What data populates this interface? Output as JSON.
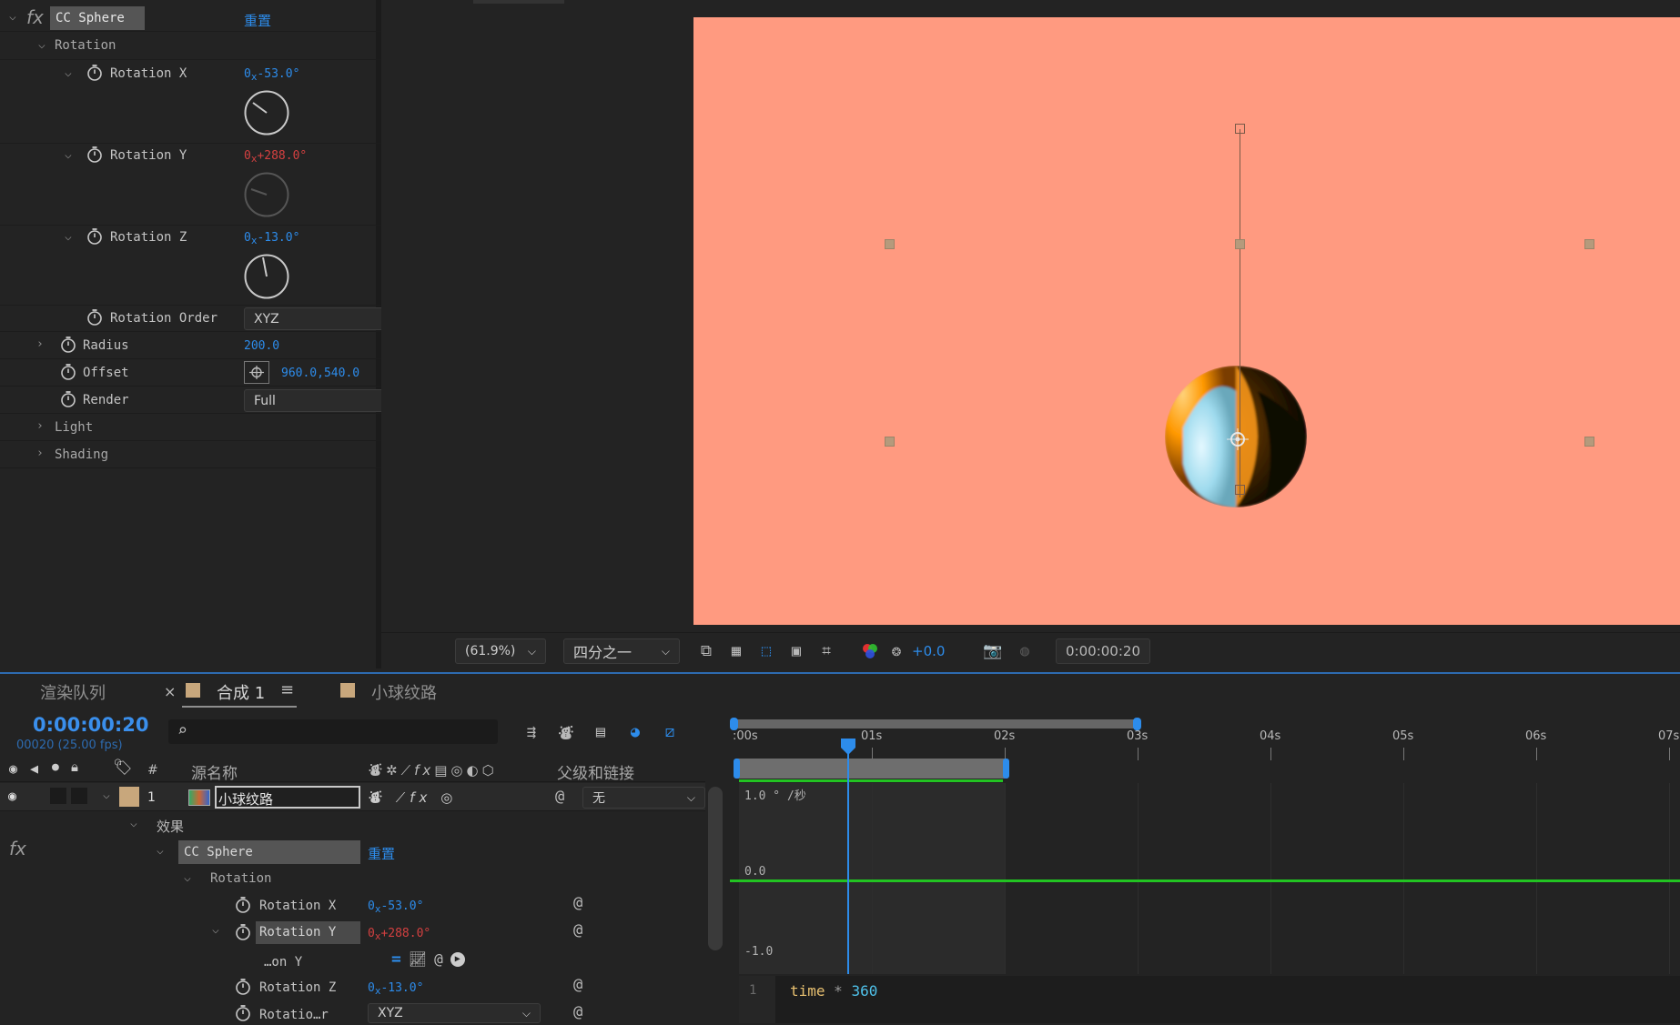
{
  "effect_controls": {
    "fx_label": "fx",
    "effect_name": "CC Sphere",
    "reset_label": "重置",
    "group_rotation": "Rotation",
    "rotation_x": {
      "label": "Rotation X",
      "revolutions": "0",
      "x": "x",
      "degrees": "-53.0",
      "unit": "°"
    },
    "rotation_y": {
      "label": "Rotation Y",
      "revolutions": "0",
      "x": "x",
      "degrees": "+288.0",
      "unit": "°"
    },
    "rotation_z": {
      "label": "Rotation Z",
      "revolutions": "0",
      "x": "x",
      "degrees": "-13.0",
      "unit": "°"
    },
    "rotation_order": {
      "label": "Rotation Order",
      "value": "XYZ"
    },
    "radius": {
      "label": "Radius",
      "value": "200.0"
    },
    "offset": {
      "label": "Offset",
      "value": "960.0,540.0"
    },
    "render": {
      "label": "Render",
      "value": "Full"
    },
    "light": "Light",
    "shading": "Shading"
  },
  "viewer": {
    "background_color": "#ff9a80",
    "zoom": "(61.9%)",
    "resolution": "四分之一",
    "exposure": "+0.0",
    "timecode": "0:00:00:20"
  },
  "tabs": {
    "render_queue": "渲染队列",
    "comp": "合成 1",
    "footage": "小球纹路"
  },
  "timeline": {
    "current_time": "0:00:00:20",
    "frame_info": "00020 (25.00 fps)",
    "search_placeholder": "",
    "col_hash": "#",
    "col_source_name": "源名称",
    "col_parent": "父级和链接",
    "layer": {
      "index": "1",
      "name": "小球纹路",
      "parent": "无",
      "label_color": "#c8a77c"
    },
    "effects_group": "效果",
    "fx_label": "fx",
    "effect_name": "CC Sphere",
    "reset_label": "重置",
    "rotation_group": "Rotation",
    "rot_x": {
      "label": "Rotation X",
      "revolutions": "0",
      "x": "x",
      "degrees": "-53.0",
      "unit": "°"
    },
    "rot_y": {
      "label": "Rotation Y",
      "revolutions": "0",
      "x": "x",
      "degrees": "+288.0",
      "unit": "°"
    },
    "expr_label": "…on Y",
    "rot_z": {
      "label": "Rotation Z",
      "revolutions": "0",
      "x": "x",
      "degrees": "-13.0",
      "unit": "°"
    },
    "rot_order": {
      "label": "Rotatio…r",
      "value": "XYZ"
    },
    "ruler_ticks": [
      ":00s",
      "01s",
      "02s",
      "03s",
      "04s",
      "05s",
      "06s",
      "07s"
    ],
    "graph_labels": {
      "top": "1.0 ° /秒",
      "middle": "0.0",
      "bottom": "-1.0"
    },
    "graph_line_color": "#22c322",
    "playhead_color": "#2d8ceb",
    "expression_line_number": "1",
    "expression": {
      "keyword": "time",
      "operator": "*",
      "number": "360"
    }
  }
}
